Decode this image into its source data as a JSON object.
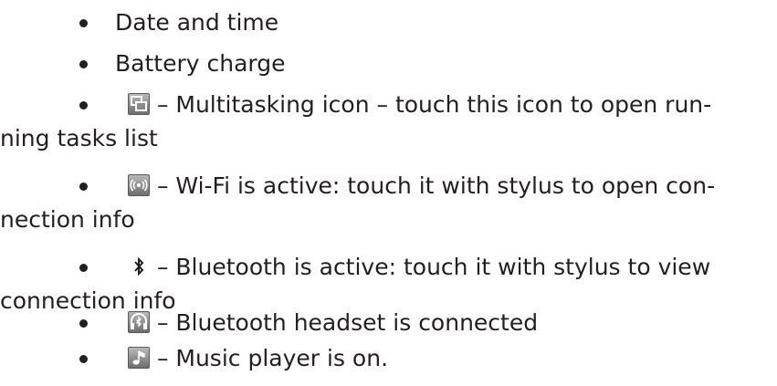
{
  "items": [
    {
      "text": "Date and time"
    },
    {
      "text": "Battery charge"
    },
    {
      "icon": "multitasking-icon",
      "text": " – Multitasking icon – touch this icon to open run-",
      "continuation": "ning tasks list"
    },
    {
      "icon": "wifi-icon",
      "text": " – Wi-Fi is active: touch it with stylus to open con-",
      "continuation": "nection info"
    },
    {
      "icon": "bluetooth-icon",
      "text": " – Bluetooth  is active: touch it with stylus to view",
      "continuation": "connection info"
    },
    {
      "icon": "bluetooth-headset-icon",
      "text": " – Bluetooth headset is connected"
    },
    {
      "icon": "music-player-icon",
      "text": " – Music player is on."
    }
  ],
  "colors": {
    "text": "#231f20",
    "icon_dark": "#5a5a5a",
    "icon_light": "#b8b8b8"
  }
}
